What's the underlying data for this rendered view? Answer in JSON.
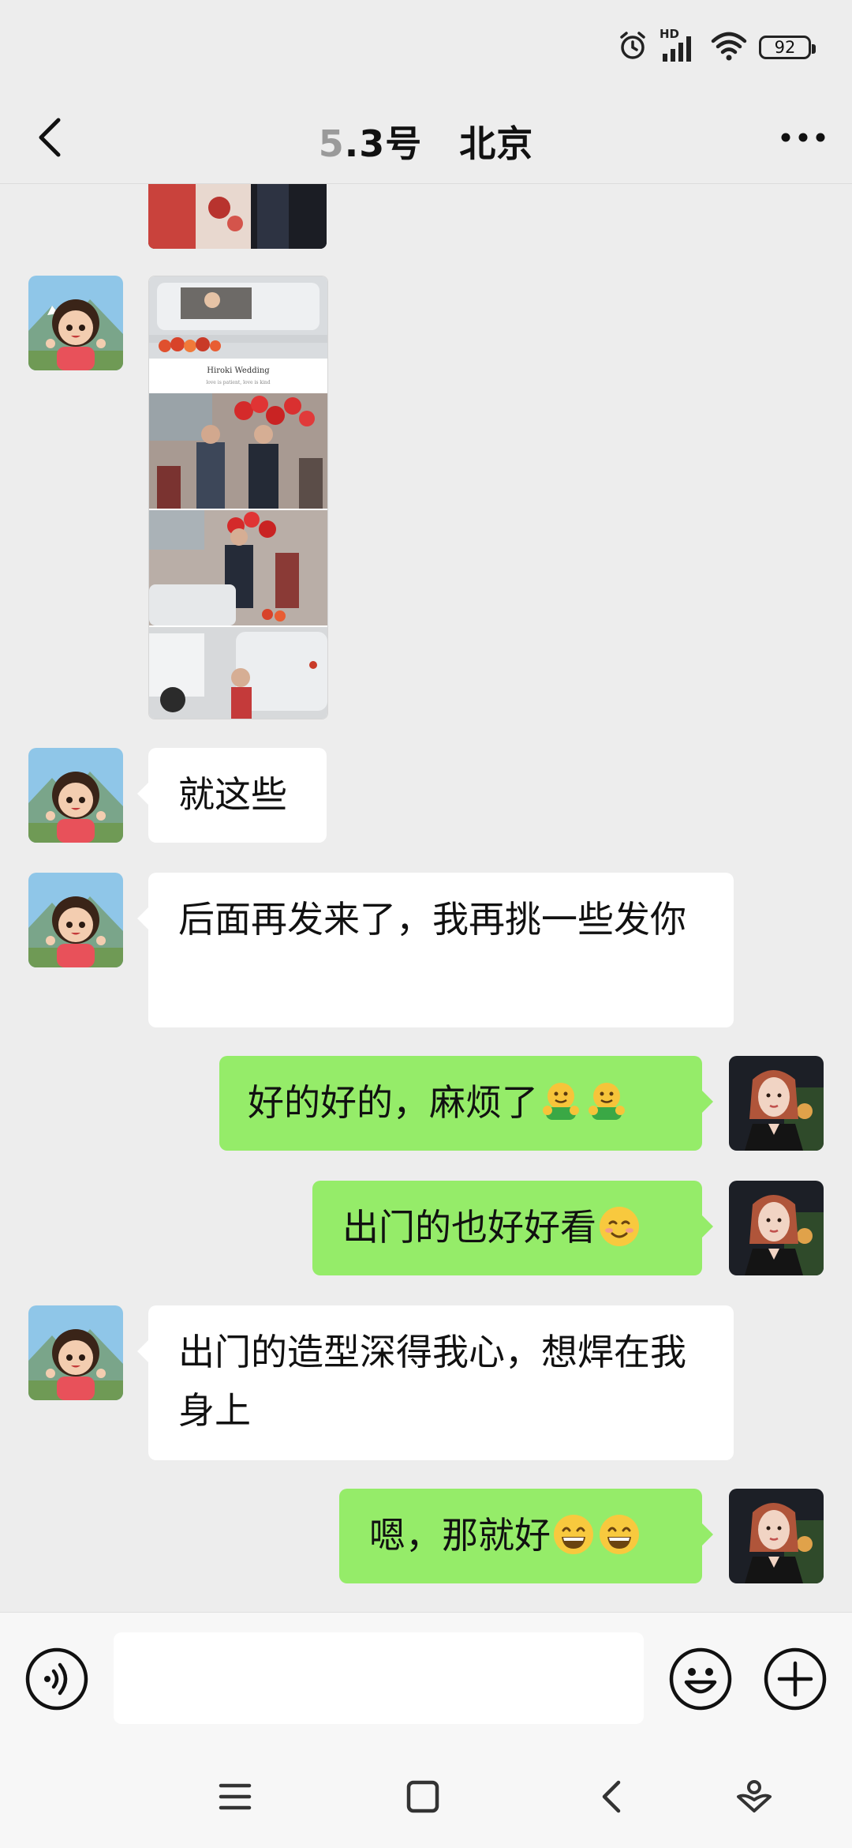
{
  "status_bar": {
    "network_label": "HD",
    "battery": "92"
  },
  "header": {
    "title_faded": "5",
    "title_rest": ".3号　北京"
  },
  "messages": [
    {
      "text": "就这些"
    },
    {
      "text": "后面再发来了，我再挑一些发你"
    },
    {
      "text": "好的好的，麻烦了"
    },
    {
      "text": "出门的也好好看"
    },
    {
      "text": "出门的造型深得我心，想焊在我身上"
    },
    {
      "text": "嗯，那就好"
    }
  ],
  "photo_strip": {
    "caption_line1": "Hiroki Wedding",
    "caption_line2": "love is patient, love is kind"
  },
  "colors": {
    "background": "#ededed",
    "incoming_bubble": "#ffffff",
    "outgoing_bubble": "#95ec69"
  }
}
